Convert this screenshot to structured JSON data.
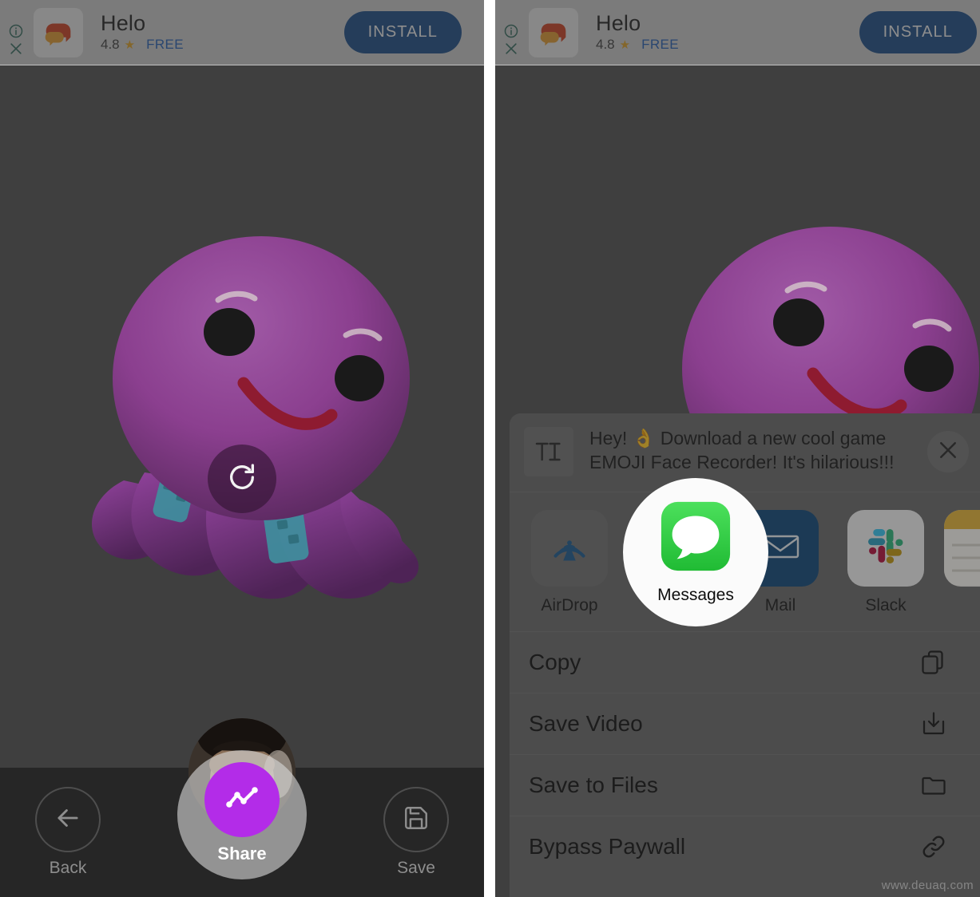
{
  "ad": {
    "app_name": "Helo",
    "rating": "4.8",
    "star_glyph": "★",
    "price_label": "FREE",
    "install_label": "INSTALL",
    "info_icon": "info-icon",
    "close_icon": "close-icon",
    "accent_button_color": "#134a8c",
    "free_text_color": "#1c5fbe",
    "star_color": "#eaa61e"
  },
  "left_panel": {
    "overlay_icon": "replay-icon",
    "controls": [
      {
        "label": "Back",
        "icon": "arrow-left-icon"
      },
      {
        "label": "Share",
        "icon": "share-graph-icon"
      },
      {
        "label": "Save",
        "icon": "floppy-disk-icon"
      }
    ],
    "highlighted_control": "Share",
    "share_accent_color": "#b32ce8",
    "bar_color": "#262626",
    "scene_bg_color": "#3f3f3f"
  },
  "share_sheet": {
    "thumb_icon": "text-format-icon",
    "message_text": "Hey! 👌 Download a new cool game EMOJI Face Recorder! It's hilarious!!!😂😂😂 Down...",
    "close_icon": "close-icon",
    "apps": [
      {
        "name": "AirDrop",
        "icon": "airdrop-icon"
      },
      {
        "name": "Messages",
        "icon": "messages-icon"
      },
      {
        "name": "Mail",
        "icon": "mail-icon"
      },
      {
        "name": "Slack",
        "icon": "slack-icon"
      },
      {
        "name": "",
        "icon": "notes-icon"
      }
    ],
    "highlighted_app": "Messages",
    "actions": [
      {
        "label": "Copy",
        "icon": "copy-icon"
      },
      {
        "label": "Save Video",
        "icon": "download-icon"
      },
      {
        "label": "Save to Files",
        "icon": "folder-icon"
      },
      {
        "label": "Bypass Paywall",
        "icon": "link-icon"
      }
    ],
    "sheet_color": "#6b6b6b"
  },
  "watermark": "www.deuaq.com"
}
